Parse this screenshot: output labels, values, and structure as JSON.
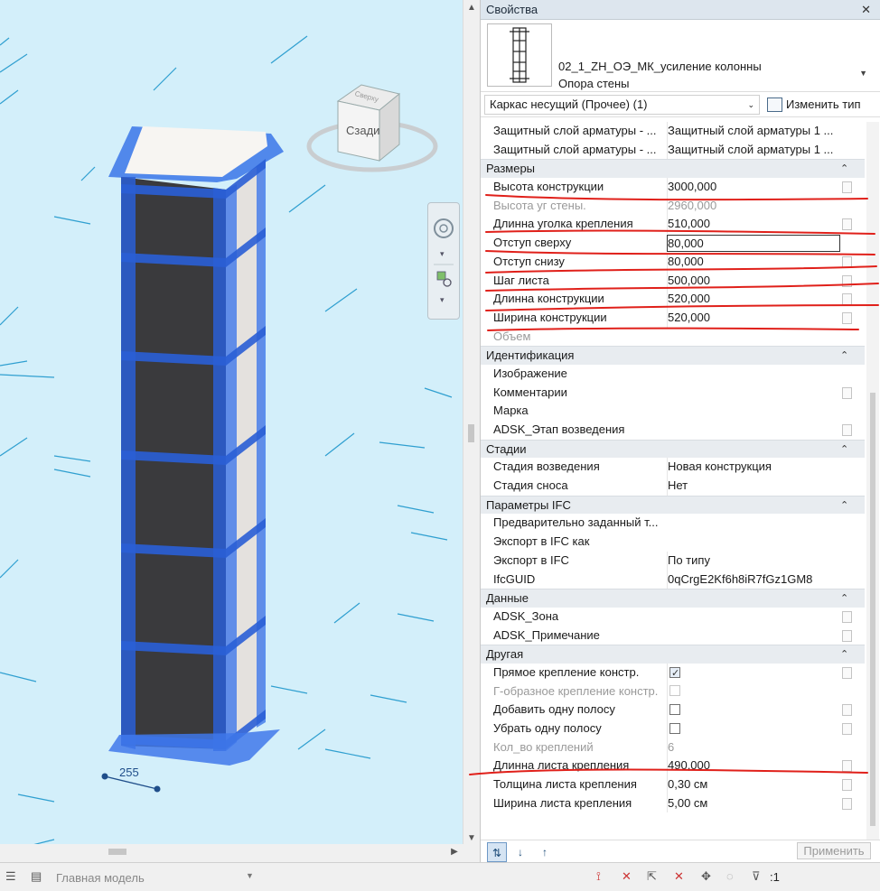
{
  "properties": {
    "title": "Свойства",
    "close_glyph": "✕",
    "type_name": "02_1_ZH_ОЭ_МК_усиление колонны",
    "type_sub": "Опора стены",
    "filter": "Каркас несущий (Прочее) (1)",
    "edit_type": "Изменить тип",
    "apply": "Применить",
    "rows": [
      {
        "kind": "param",
        "name": "Защитный слой арматуры - ...",
        "value": "Защитный слой арматуры 1 ...",
        "checkbox": false
      },
      {
        "kind": "param",
        "name": "Защитный слой арматуры - ...",
        "value": "Защитный слой арматуры 1 ...",
        "checkbox": false
      },
      {
        "kind": "group",
        "name": "Размеры"
      },
      {
        "kind": "param",
        "name": "Высота конструкции",
        "value": "3000,000",
        "checkbox": true
      },
      {
        "kind": "param",
        "name": "Высота уг стены.",
        "value": "2960,000",
        "disabled": true,
        "checkbox": false
      },
      {
        "kind": "param",
        "name": "Длинна уголка крепления",
        "value": "510,000",
        "checkbox": true
      },
      {
        "kind": "param",
        "name": "Отступ сверху",
        "value": "80,000",
        "selected": true,
        "checkbox": false
      },
      {
        "kind": "param",
        "name": "Отступ снизу",
        "value": "80,000",
        "checkbox": true
      },
      {
        "kind": "param",
        "name": "Шаг листа",
        "value": "500,000",
        "checkbox": true
      },
      {
        "kind": "param",
        "name": "Длинна конструкции",
        "value": "520,000",
        "checkbox": true
      },
      {
        "kind": "param",
        "name": "Ширина конструкции",
        "value": "520,000",
        "checkbox": true
      },
      {
        "kind": "param",
        "name": "Объем",
        "value": "",
        "disabled": true,
        "checkbox": false
      },
      {
        "kind": "group",
        "name": "Идентификация"
      },
      {
        "kind": "param",
        "name": "Изображение",
        "value": "",
        "checkbox": false
      },
      {
        "kind": "param",
        "name": "Комментарии",
        "value": "",
        "checkbox": true
      },
      {
        "kind": "param",
        "name": "Марка",
        "value": "",
        "checkbox": false
      },
      {
        "kind": "param",
        "name": "ADSK_Этап возведения",
        "value": "",
        "checkbox": true
      },
      {
        "kind": "group",
        "name": "Стадии"
      },
      {
        "kind": "param",
        "name": "Стадия возведения",
        "value": "Новая конструкция",
        "checkbox": false
      },
      {
        "kind": "param",
        "name": "Стадия сноса",
        "value": "Нет",
        "checkbox": false
      },
      {
        "kind": "group",
        "name": "Параметры IFC"
      },
      {
        "kind": "param",
        "name": "Предварительно заданный т...",
        "value": "",
        "checkbox": false
      },
      {
        "kind": "param",
        "name": "Экспорт в IFC как",
        "value": "",
        "checkbox": false
      },
      {
        "kind": "param",
        "name": "Экспорт в IFC",
        "value": "По типу",
        "checkbox": false
      },
      {
        "kind": "param",
        "name": "IfcGUID",
        "value": "0qCrgE2Kf6h8iR7fGz1GM8",
        "checkbox": false
      },
      {
        "kind": "group",
        "name": "Данные"
      },
      {
        "kind": "param",
        "name": "ADSK_Зона",
        "value": "",
        "checkbox": true
      },
      {
        "kind": "param",
        "name": "ADSK_Примечание",
        "value": "",
        "checkbox": true
      },
      {
        "kind": "group",
        "name": "Другая"
      },
      {
        "kind": "param",
        "name": "Прямое крепление констр.",
        "value": "",
        "valcheck": "on",
        "checkbox": true
      },
      {
        "kind": "param",
        "name": "Г-образное крепление констр.",
        "value": "",
        "valcheck": "dis",
        "disabled": true,
        "checkbox": false
      },
      {
        "kind": "param",
        "name": "Добавить одну полосу",
        "value": "",
        "valcheck": "off",
        "checkbox": true
      },
      {
        "kind": "param",
        "name": "Убрать одну полосу",
        "value": "",
        "valcheck": "off",
        "checkbox": true
      },
      {
        "kind": "param",
        "name": "Кол_во креплений",
        "value": "6",
        "disabled": true,
        "checkbox": false
      },
      {
        "kind": "param",
        "name": "Длинна листа крепления",
        "value": "490,000",
        "checkbox": true
      },
      {
        "kind": "param",
        "name": "Толщина листа крепления",
        "value": "0,30 см",
        "checkbox": true
      },
      {
        "kind": "param",
        "name": "Ширина листа крепления",
        "value": "5,00 см",
        "checkbox": true
      }
    ]
  },
  "viewport": {
    "viewcube_face": "Сзади",
    "viewcube_top": "Сверху",
    "dimension": "255"
  },
  "statusbar": {
    "model": "Главная модель",
    "filter_count": ":1"
  },
  "colors": {
    "viewport_bg": "#d3effa",
    "selection_blue": "#2a63e6",
    "annotation_red": "#e0201a"
  },
  "icons": [
    "close-icon",
    "chevron-down-icon",
    "edit-type-icon",
    "collapse-icon",
    "steering-wheel-icon",
    "zoom-icon",
    "sort-icon",
    "filter-icon"
  ]
}
